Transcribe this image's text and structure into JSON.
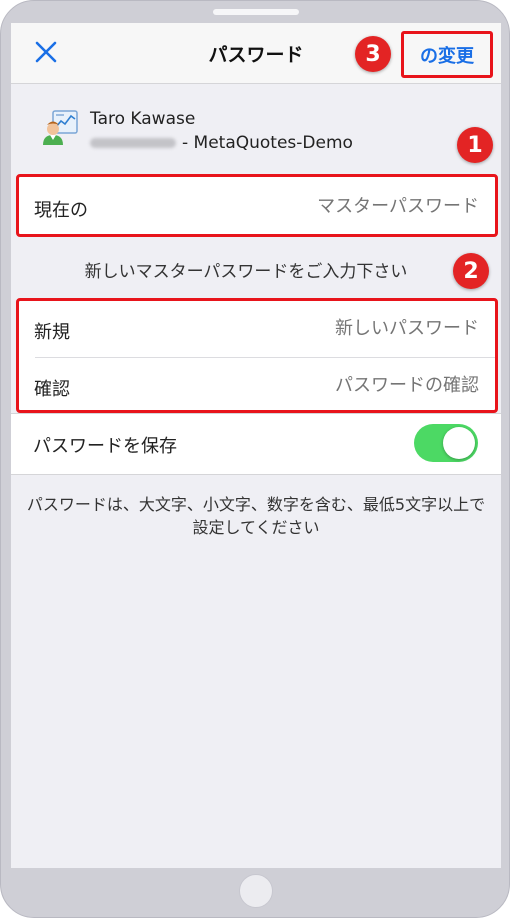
{
  "nav": {
    "title": "パスワード",
    "change_label": "の変更",
    "close_icon": "close-icon"
  },
  "account": {
    "name": "Taro Kawase",
    "server_suffix": "- MetaQuotes-Demo",
    "icon": "account-avatar-icon"
  },
  "current": {
    "label": "現在の",
    "placeholder": "マスターパスワード"
  },
  "new_prompt": "新しいマスターパスワードをご入力下さい",
  "new_password": {
    "label": "新規",
    "placeholder": "新しいパスワード"
  },
  "confirm_password": {
    "label": "確認",
    "placeholder": "パスワードの確認"
  },
  "save_password": {
    "label": "パスワードを保存",
    "enabled": true
  },
  "footer_note": "パスワードは、大文字、小文字、数字を含む、最低5文字以上で設定してください",
  "annotations": {
    "badge_1": "1",
    "badge_2": "2",
    "badge_3": "3"
  },
  "colors": {
    "accent": "#1a6fe6",
    "highlight": "#e8141b",
    "toggle_on": "#4cd964",
    "badge": "#e32424"
  }
}
